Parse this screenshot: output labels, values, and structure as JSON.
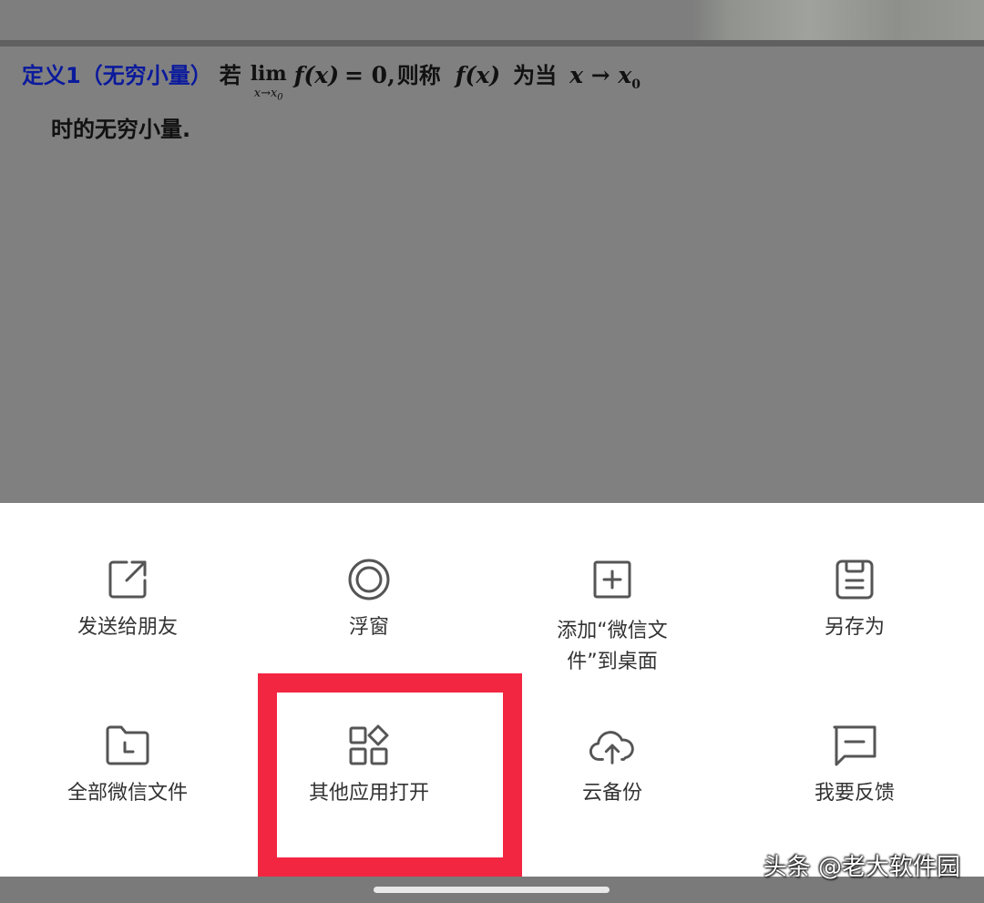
{
  "document": {
    "def_label": "定义1（无穷小量）",
    "word_if": "若",
    "lim": "lim",
    "lim_sub": "x→x",
    "lim_sub_index": "0",
    "fx_eq": "f(x)",
    "eq_zero": "= 0,",
    "word_then_called": "则称",
    "fx": "f(x)",
    "word_when": "为当",
    "x_to": "x → x",
    "x0_index": "0",
    "second_line": "时的无穷小量."
  },
  "actions": [
    {
      "label": "发送给朋友",
      "icon": "share-external-icon"
    },
    {
      "label": "浮窗",
      "icon": "floating-window-icon"
    },
    {
      "label": "添加“微信文件”到桌面",
      "icon": "add-to-desktop-icon"
    },
    {
      "label": "另存为",
      "icon": "save-as-icon"
    },
    {
      "label": "全部微信文件",
      "icon": "folder-clock-icon"
    },
    {
      "label": "其他应用打开",
      "icon": "apps-grid-icon"
    },
    {
      "label": "云备份",
      "icon": "cloud-upload-icon"
    },
    {
      "label": "我要反馈",
      "icon": "feedback-message-icon"
    }
  ],
  "highlight_color": "#f32642",
  "watermark": "头条 @老大软件园"
}
